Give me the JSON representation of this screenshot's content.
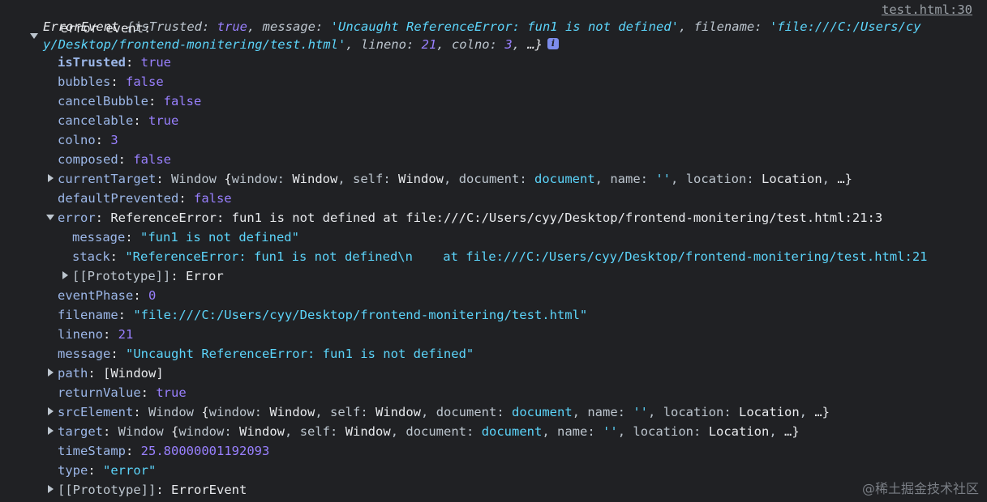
{
  "header": {
    "label": "error event:",
    "source_link": "test.html:30"
  },
  "summary": {
    "type_name": "ErrorEvent",
    "line1": {
      "k1": "isTrusted",
      "v1": "true",
      "k2": "message",
      "v2": "'Uncaught ReferenceError: fun1 is not defined'",
      "k3": "filename",
      "v3a": "'file:///C:/Users/cy"
    },
    "line2": {
      "v3b": "y/Desktop/frontend-monitering/test.html'",
      "k4": "lineno",
      "v4": "21",
      "k5": "colno",
      "v5": "3",
      "ellipsis": "…}"
    },
    "info_icon": "info-icon"
  },
  "props": {
    "isTrusted": {
      "key": "isTrusted",
      "value": "true"
    },
    "bubbles": {
      "key": "bubbles",
      "value": "false"
    },
    "cancelBubble": {
      "key": "cancelBubble",
      "value": "false"
    },
    "cancelable": {
      "key": "cancelable",
      "value": "true"
    },
    "colno": {
      "key": "colno",
      "value": "3"
    },
    "composed": {
      "key": "composed",
      "value": "false"
    },
    "currentTarget": {
      "key": "currentTarget",
      "type": "Window",
      "p1k": "window",
      "p1v": "Window",
      "p2k": "self",
      "p2v": "Window",
      "p3k": "document",
      "p3v": "document",
      "p4k": "name",
      "p4v": "''",
      "p5k": "location",
      "p5v": "Location",
      "tail": "…}"
    },
    "defaultPrevented": {
      "key": "defaultPrevented",
      "value": "false"
    },
    "error": {
      "key": "error",
      "value": "ReferenceError: fun1 is not defined at file:///C:/Users/cyy/Desktop/frontend-monitering/test.html:21:3",
      "message_key": "message",
      "message_value": "\"fun1 is not defined\"",
      "stack_key": "stack",
      "stack_value": "\"ReferenceError: fun1 is not defined\\n    at file:///C:/Users/cyy/Desktop/frontend-monitering/test.html:21",
      "proto_key": "[[Prototype]]",
      "proto_value": "Error"
    },
    "eventPhase": {
      "key": "eventPhase",
      "value": "0"
    },
    "filename": {
      "key": "filename",
      "value": "\"file:///C:/Users/cyy/Desktop/frontend-monitering/test.html\""
    },
    "lineno": {
      "key": "lineno",
      "value": "21"
    },
    "message": {
      "key": "message",
      "value": "\"Uncaught ReferenceError: fun1 is not defined\""
    },
    "path": {
      "key": "path",
      "value": "[Window]"
    },
    "returnValue": {
      "key": "returnValue",
      "value": "true"
    },
    "srcElement": {
      "key": "srcElement",
      "type": "Window",
      "p1k": "window",
      "p1v": "Window",
      "p2k": "self",
      "p2v": "Window",
      "p3k": "document",
      "p3v": "document",
      "p4k": "name",
      "p4v": "''",
      "p5k": "location",
      "p5v": "Location",
      "tail": "…}"
    },
    "target": {
      "key": "target",
      "type": "Window",
      "p1k": "window",
      "p1v": "Window",
      "p2k": "self",
      "p2v": "Window",
      "p3k": "document",
      "p3v": "document",
      "p4k": "name",
      "p4v": "''",
      "p5k": "location",
      "p5v": "Location",
      "tail": "…}"
    },
    "timeStamp": {
      "key": "timeStamp",
      "value": "25.80000001192093"
    },
    "type": {
      "key": "type",
      "value": "\"error\""
    },
    "prototype": {
      "key": "[[Prototype]]",
      "value": "ErrorEvent"
    }
  },
  "watermark": "@稀土掘金技术社区",
  "colors": {
    "background": "#202124",
    "key": "#9cb7e8",
    "string": "#5cd5fb",
    "number": "#9980ff",
    "text": "#e8eaed"
  }
}
